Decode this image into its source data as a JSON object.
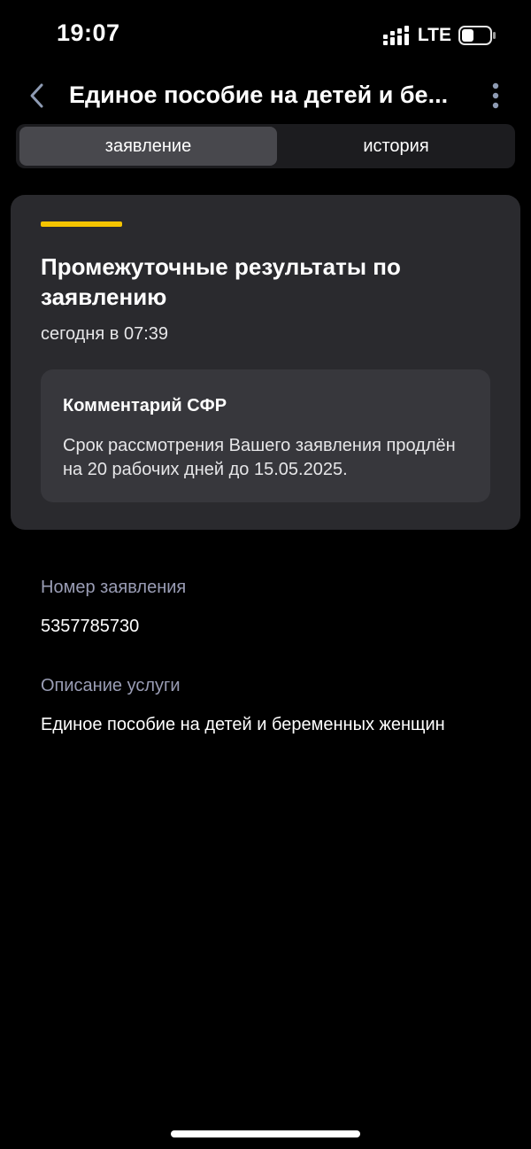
{
  "status_bar": {
    "time": "19:07",
    "network": "LTE",
    "icons": [
      "signal-bars-icon",
      "battery-icon"
    ]
  },
  "header": {
    "title": "Единое пособие на детей и бе...",
    "back_icon": "chevron-left-icon",
    "more_icon": "more-vertical-icon"
  },
  "tabs": [
    {
      "label": "заявление",
      "active": true
    },
    {
      "label": "история",
      "active": false
    }
  ],
  "result_card": {
    "title": "Промежуточные результаты по заявлению",
    "date": "сегодня в 07:39",
    "accent_color": "#F5C400",
    "comment": {
      "title": "Комментарий СФР",
      "text": "Срок рассмотрения Вашего заявления продлён на 20 рабочих дней до 15.05.2025."
    }
  },
  "details": [
    {
      "label": "Номер заявления",
      "value": "5357785730"
    },
    {
      "label": "Описание услуги",
      "value": "Единое пособие на детей и беременных женщин"
    }
  ],
  "colors": {
    "background": "#000000",
    "card": "#2A2A2E",
    "comment_box": "#37373C",
    "segment_active": "#48484D",
    "label_muted": "#9A9DB5"
  }
}
